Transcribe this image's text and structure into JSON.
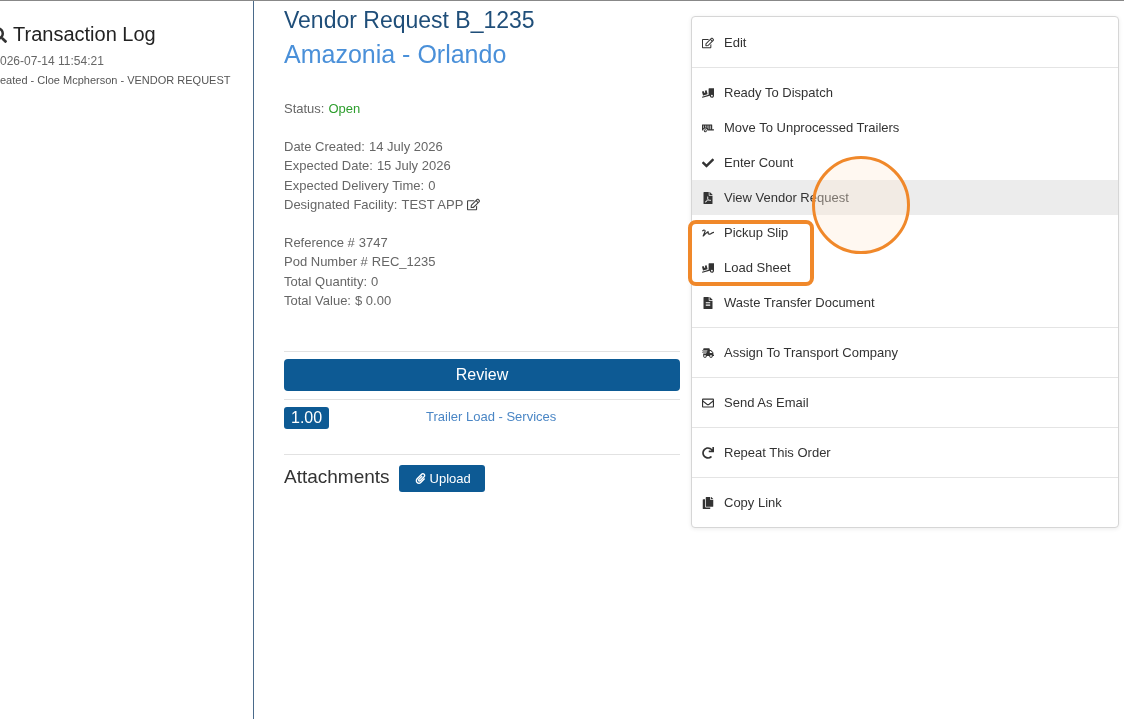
{
  "transaction_log": {
    "title": "Transaction Log",
    "entries": [
      {
        "time": "026-07-14 11:54:21",
        "text": "eated - Cloe Mcpherson - VENDOR REQUEST"
      }
    ]
  },
  "order": {
    "title": "Vendor Request B_1235",
    "subtitle": "Amazonia - Orlando",
    "status": {
      "label": "Status:",
      "value": "Open"
    },
    "dates": [
      {
        "label": "Date Created:",
        "value": "14 July 2026"
      },
      {
        "label": "Expected Date:",
        "value": "15 July 2026"
      },
      {
        "label": "Expected Delivery Time:",
        "value": "0"
      },
      {
        "label": "Designated Facility:",
        "value": "TEST APP",
        "editable": true
      }
    ],
    "references": [
      {
        "label": "Reference #",
        "value": "3747"
      },
      {
        "label": "Pod Number #",
        "value": "REC_1235"
      },
      {
        "label": "Total Quantity:",
        "value": "0"
      },
      {
        "label": "Total Value:",
        "value": "$ 0.00"
      }
    ],
    "review_button": "Review",
    "lines": [
      {
        "quantity": "1.00",
        "item": "Trailer Load - Services"
      }
    ],
    "attachments": {
      "title": "Attachments",
      "upload_button": "Upload"
    }
  },
  "menu": {
    "groups": [
      {
        "items": [
          {
            "kind": "edit",
            "label": "Edit",
            "selected": false
          }
        ]
      },
      {
        "items": [
          {
            "kind": "dolly",
            "label": "Ready To Dispatch",
            "selected": false
          },
          {
            "kind": "trailer",
            "label": "Move To Unprocessed Trailers",
            "selected": false
          },
          {
            "kind": "check",
            "label": "Enter Count",
            "selected": false
          },
          {
            "kind": "pdf",
            "label": "View Vendor Request",
            "selected": true
          },
          {
            "kind": "signature",
            "label": "Pickup Slip",
            "selected": false
          },
          {
            "kind": "dolly",
            "label": "Load Sheet",
            "selected": false
          },
          {
            "kind": "document",
            "label": "Waste Transfer Document",
            "selected": false
          }
        ]
      },
      {
        "items": [
          {
            "kind": "truck",
            "label": "Assign To Transport Company",
            "selected": false
          }
        ]
      },
      {
        "items": [
          {
            "kind": "mail",
            "label": "Send As Email",
            "selected": false
          }
        ]
      },
      {
        "items": [
          {
            "kind": "redo",
            "label": "Repeat This Order",
            "selected": false
          }
        ]
      },
      {
        "items": [
          {
            "kind": "copy",
            "label": "Copy Link",
            "selected": false
          }
        ]
      }
    ]
  }
}
